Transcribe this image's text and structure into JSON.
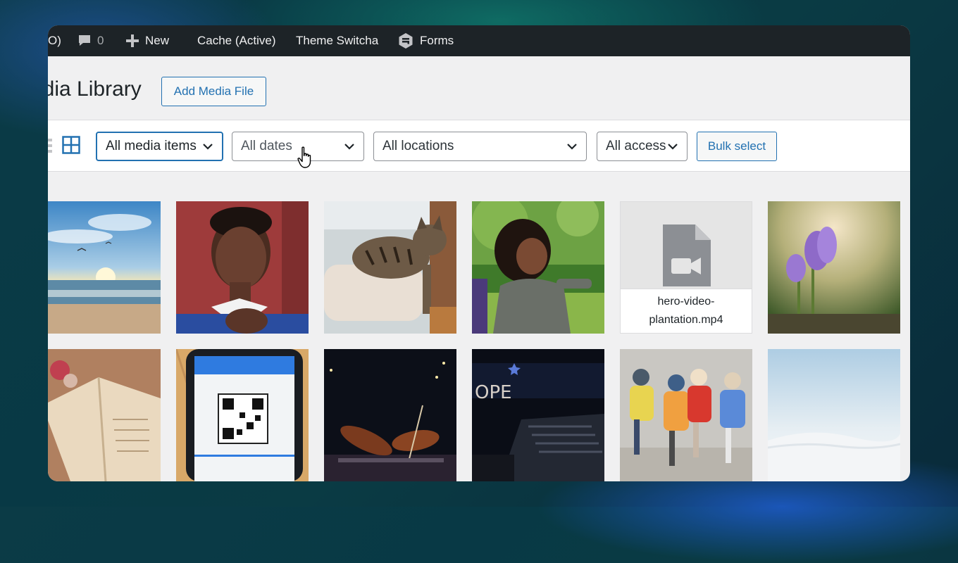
{
  "admin_bar": {
    "count_partial": "O)",
    "comments_count": "0",
    "new_label": "New",
    "cache_label": "Cache (Active)",
    "theme_label": "Theme Switcha",
    "forms_label": "Forms"
  },
  "header": {
    "title": "edia Library",
    "add_button": "Add Media File"
  },
  "toolbar": {
    "media_filter": "All media items",
    "date_filter": "All dates",
    "location_filter": "All locations",
    "access_filter": "All access",
    "bulk_button": "Bulk select"
  },
  "media": {
    "video_filename": "hero-video-plantation.mp4"
  },
  "colors": {
    "accent": "#2271b1",
    "admin_bar": "#1d2327",
    "page_bg": "#f0f0f1"
  },
  "icons": [
    "comment-icon",
    "plus-icon",
    "forms-icon",
    "list-view-icon",
    "grid-view-icon",
    "chevron-down-icon",
    "video-file-icon",
    "pointer-hand-icon"
  ]
}
